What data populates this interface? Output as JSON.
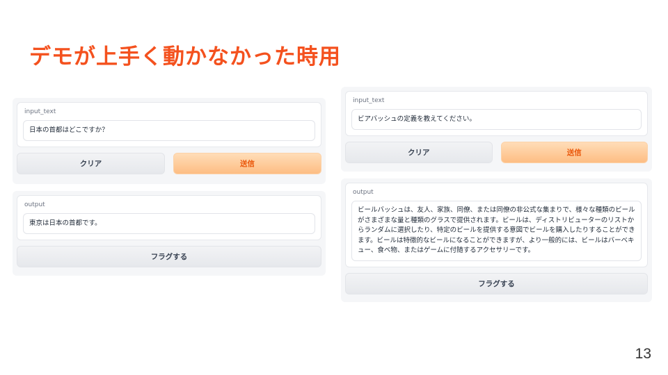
{
  "slide": {
    "title": "デモが上手く動かなかった時用",
    "page_number": "13"
  },
  "left_demo": {
    "input_label": "input_text",
    "input_value": "日本の首都はどこですか？",
    "clear_label": "クリア",
    "submit_label": "送信",
    "output_label": "output",
    "output_value": "東京は日本の首都です。",
    "flag_label": "フラグする"
  },
  "right_demo": {
    "input_label": "input_text",
    "input_value": "ビアバッシュの定義を教えてください。",
    "clear_label": "クリア",
    "submit_label": "送信",
    "output_label": "output",
    "output_value": "ビールバッシュは、友人、家族、同僚、または同僚の非公式な集まりで、様々な種類のビールがさまざまな量と種類のグラスで提供されます。ビールは、ディストリビューターのリストからランダムに選択したり、特定のビールを提供する意図でビールを購入したりすることができます。ビールは特徴的なビールになることができますが、より一般的には、ビールはバーベキュー、食べ物、またはゲームに付随するアクセサリーです。",
    "flag_label": "フラグする"
  },
  "colors": {
    "title": "#f4511e",
    "primary_button": "#fdbd83",
    "primary_text": "#ea580c"
  }
}
